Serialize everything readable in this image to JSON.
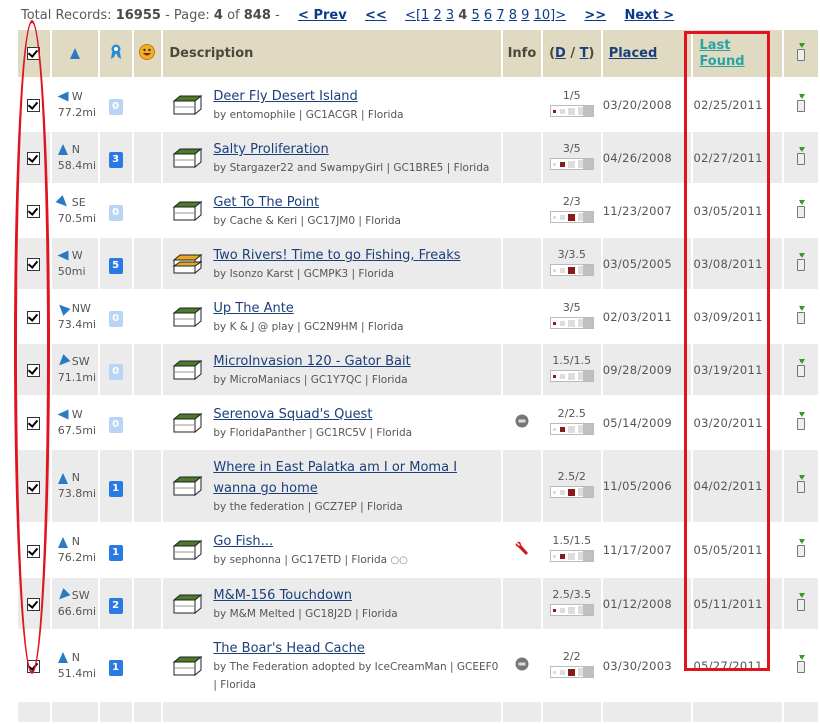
{
  "pager": {
    "total_label": "Total Records:",
    "total": "16955",
    "page_label": "- Page:",
    "page": "4",
    "of_label": "of",
    "pages": "848",
    "dash": "-",
    "prev": "< Prev",
    "first": "<<",
    "range_open": "<[",
    "page_links": [
      "1",
      "2",
      "3",
      "4",
      "5",
      "6",
      "7",
      "8",
      "9",
      "10"
    ],
    "current_page": "4",
    "range_close": "]>",
    "last": ">>",
    "next": "Next >"
  },
  "header": {
    "description": "Description",
    "info": "Info",
    "dt_open": "(",
    "d": "D",
    "slash": "/",
    "t": "T",
    "dt_close": ")",
    "placed": "Placed",
    "last_found": "Last Found"
  },
  "colors": {
    "annotation_red": "#e0131f",
    "header_bg": "#e0dac2",
    "link": "#1b3f7a",
    "badge_blue": "#2a7ae4",
    "difficulty_red": "#8b1a1a"
  },
  "rows": [
    {
      "dir": "W",
      "dist": "77.2mi",
      "fav": "0",
      "title": "Deer Fly Desert Island",
      "by": "by entomophile | GC1ACGR | Florida",
      "info": "",
      "dt": "1/5",
      "placed": "03/20/2008",
      "last_found": "02/25/2011",
      "box": "regular",
      "level": 1
    },
    {
      "dir": "N",
      "dist": "58.4mi",
      "fav": "3",
      "title": "Salty Proliferation",
      "by": "by Stargazer22 and SwampyGirl | GC1BRE5 | Florida",
      "info": "",
      "dt": "3/5",
      "placed": "04/26/2008",
      "last_found": "02/27/2011",
      "box": "regular",
      "level": 2
    },
    {
      "dir": "SE",
      "dist": "70.5mi",
      "fav": "0",
      "title": "Get To The Point",
      "by": "by Cache & Keri | GC17JM0 | Florida",
      "info": "",
      "dt": "2/3",
      "placed": "11/23/2007",
      "last_found": "03/05/2011",
      "box": "regular",
      "level": 3
    },
    {
      "dir": "W",
      "dist": "50mi",
      "fav": "5",
      "title": "Two Rivers! Time to go Fishing, Freaks",
      "by": "by Isonzo Karst | GCMPK3 | Florida",
      "info": "",
      "dt": "3/3.5",
      "placed": "03/05/2005",
      "last_found": "03/08/2011",
      "box": "multi",
      "level": 3
    },
    {
      "dir": "NW",
      "dist": "73.4mi",
      "fav": "0",
      "title": "Up The Ante",
      "by": "by K & J @ play | GC2N9HM | Florida",
      "info": "",
      "dt": "3/5",
      "placed": "02/03/2011",
      "last_found": "03/09/2011",
      "box": "regular",
      "level": 1
    },
    {
      "dir": "SW",
      "dist": "71.1mi",
      "fav": "0",
      "title": "MicroInvasion 120 - Gator Bait",
      "by": "by MicroManiacs | GC1Y7QC | Florida",
      "info": "",
      "dt": "1.5/1.5",
      "placed": "09/28/2009",
      "last_found": "03/19/2011",
      "box": "regular",
      "level": 1
    },
    {
      "dir": "W",
      "dist": "67.5mi",
      "fav": "0",
      "title": "Serenova Squad's Quest",
      "by": "by FloridaPanther | GC1RC5V | Florida",
      "info": "travel-bug-icon",
      "dt": "2/2.5",
      "placed": "05/14/2009",
      "last_found": "03/20/2011",
      "box": "regular",
      "level": 2
    },
    {
      "dir": "N",
      "dist": "73.8mi",
      "fav": "1",
      "title": "Where in East Palatka am I or Moma I wanna go home",
      "by": "by the federation | GCZ7EP | Florida",
      "info": "",
      "dt": "2.5/2",
      "placed": "11/05/2006",
      "last_found": "04/02/2011",
      "box": "regular",
      "level": 3
    },
    {
      "dir": "N",
      "dist": "76.2mi",
      "fav": "1",
      "title": "Go Fish...",
      "by": "by sephonna | GC17ETD | Florida",
      "info": "wrench-icon",
      "watch": true,
      "dt": "1.5/1.5",
      "placed": "11/17/2007",
      "last_found": "05/05/2011",
      "box": "regular",
      "level": 2
    },
    {
      "dir": "SW",
      "dist": "66.6mi",
      "fav": "2",
      "title": "M&M-156 Touchdown",
      "by": "by M&M Melted | GC18J2D | Florida",
      "info": "",
      "dt": "2.5/3.5",
      "placed": "01/12/2008",
      "last_found": "05/11/2011",
      "box": "regular",
      "level": 1
    },
    {
      "dir": "N",
      "dist": "51.4mi",
      "fav": "1",
      "title": "The Boar's Head Cache",
      "by": "by The Federation adopted by IceCreamMan | GCEEF0 | Florida",
      "info": "travel-bug-icon",
      "dt": "2/2",
      "placed": "03/30/2003",
      "last_found": "05/27/2011",
      "box": "regular",
      "level": 3
    }
  ]
}
